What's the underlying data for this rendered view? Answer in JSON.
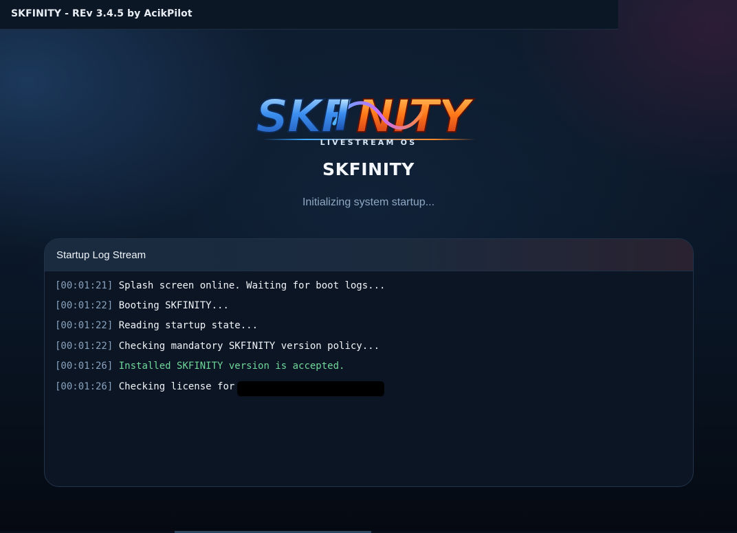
{
  "window": {
    "title": "SKFINITY - REv 3.4.5 by AcikPilot"
  },
  "logo": {
    "wordmark": "SKFINITY",
    "tagline": "LIVESTREAM OS",
    "colors": {
      "blue": "#2f7fe0",
      "orange": "#ff7a1a"
    }
  },
  "splash": {
    "app_name": "SKFINITY",
    "status": "Initializing system startup..."
  },
  "log": {
    "header": "Startup Log Stream",
    "lines": [
      {
        "time": "[00:01:21]",
        "message": "Splash screen online. Waiting for boot logs..."
      },
      {
        "time": "[00:01:22]",
        "message": "Booting SKFINITY..."
      },
      {
        "time": "[00:01:22]",
        "message": "Reading startup state..."
      },
      {
        "time": "[00:01:22]",
        "message": "Checking mandatory SKFINITY version policy..."
      },
      {
        "time": "[00:01:26]",
        "message": "Installed SKFINITY version is accepted."
      },
      {
        "time": "[00:01:26]",
        "message": "Checking license for"
      }
    ],
    "colors": {
      "timestamp": "#8aa3bf",
      "message": "#f2f5f9",
      "success": "#6fd89a"
    }
  }
}
